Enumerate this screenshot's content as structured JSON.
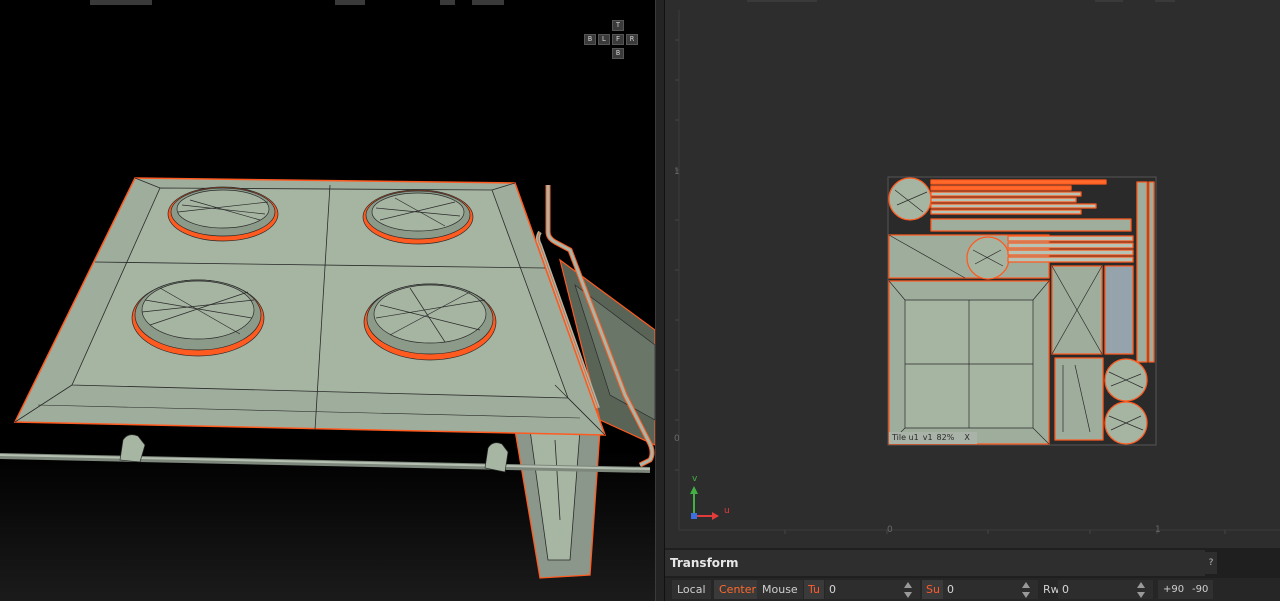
{
  "viewport": {
    "nav_cube": {
      "top": "T",
      "back": "B",
      "left": "L",
      "front": "F",
      "right": "R",
      "bottom": "B"
    }
  },
  "uv_editor": {
    "v_tick_top": "1",
    "v_tick_bottom": "0",
    "u_tick_left": "0",
    "u_tick_right": "1",
    "tile_label": {
      "tile": "Tile u1",
      "v": "v1",
      "zoom": "82%",
      "close": "X"
    },
    "gizmo": {
      "v_axis": "v",
      "u_axis": "u"
    }
  },
  "transform": {
    "title": "Transform",
    "help": "?",
    "local": "Local",
    "center": "Center",
    "mouse": "Mouse",
    "tu_label": "Tu",
    "tu_value": "0",
    "su_label": "Su",
    "su_value": "0",
    "rw_label": "Rw",
    "rw_value": "0",
    "rot_plus": "+90",
    "rot_minus": "-90"
  },
  "colors": {
    "accent": "#ff5a1f",
    "mesh": "#9fae9c",
    "edge": "#2a2a2a",
    "uv_background": "#2d2d2d"
  }
}
